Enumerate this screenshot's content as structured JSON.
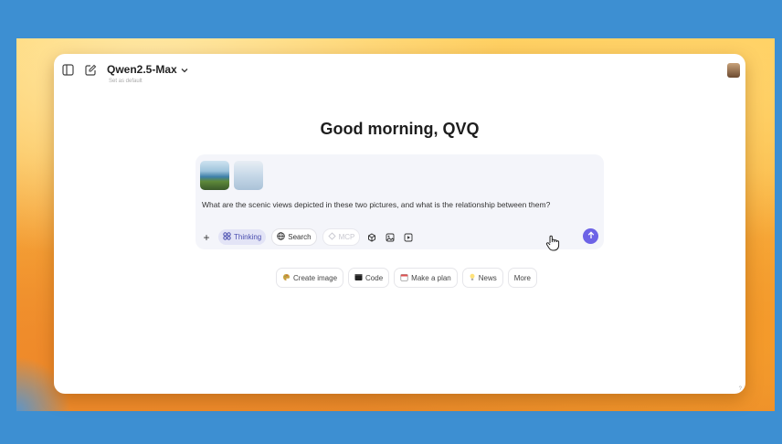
{
  "header": {
    "model_name": "Qwen2.5-Max",
    "model_subtitle": "Set as default"
  },
  "main": {
    "greeting": "Good morning, QVQ"
  },
  "composer": {
    "prompt_text": "What are the scenic views depicted in these two pictures, and what is the relationship between them?",
    "toolbar": {
      "plus_label": "+",
      "thinking_label": "Thinking",
      "search_label": "Search",
      "mcp_label": "MCP"
    }
  },
  "suggestions": [
    {
      "label": "Create image",
      "icon": "palette-icon"
    },
    {
      "label": "Code",
      "icon": "code-icon"
    },
    {
      "label": "Make a plan",
      "icon": "calendar-icon"
    },
    {
      "label": "News",
      "icon": "lightbulb-icon"
    },
    {
      "label": "More",
      "icon": ""
    }
  ],
  "colors": {
    "accent": "#6d63e6",
    "thinking_bg": "#e3e4f6",
    "desktop_blue": "#3d8fd2"
  }
}
